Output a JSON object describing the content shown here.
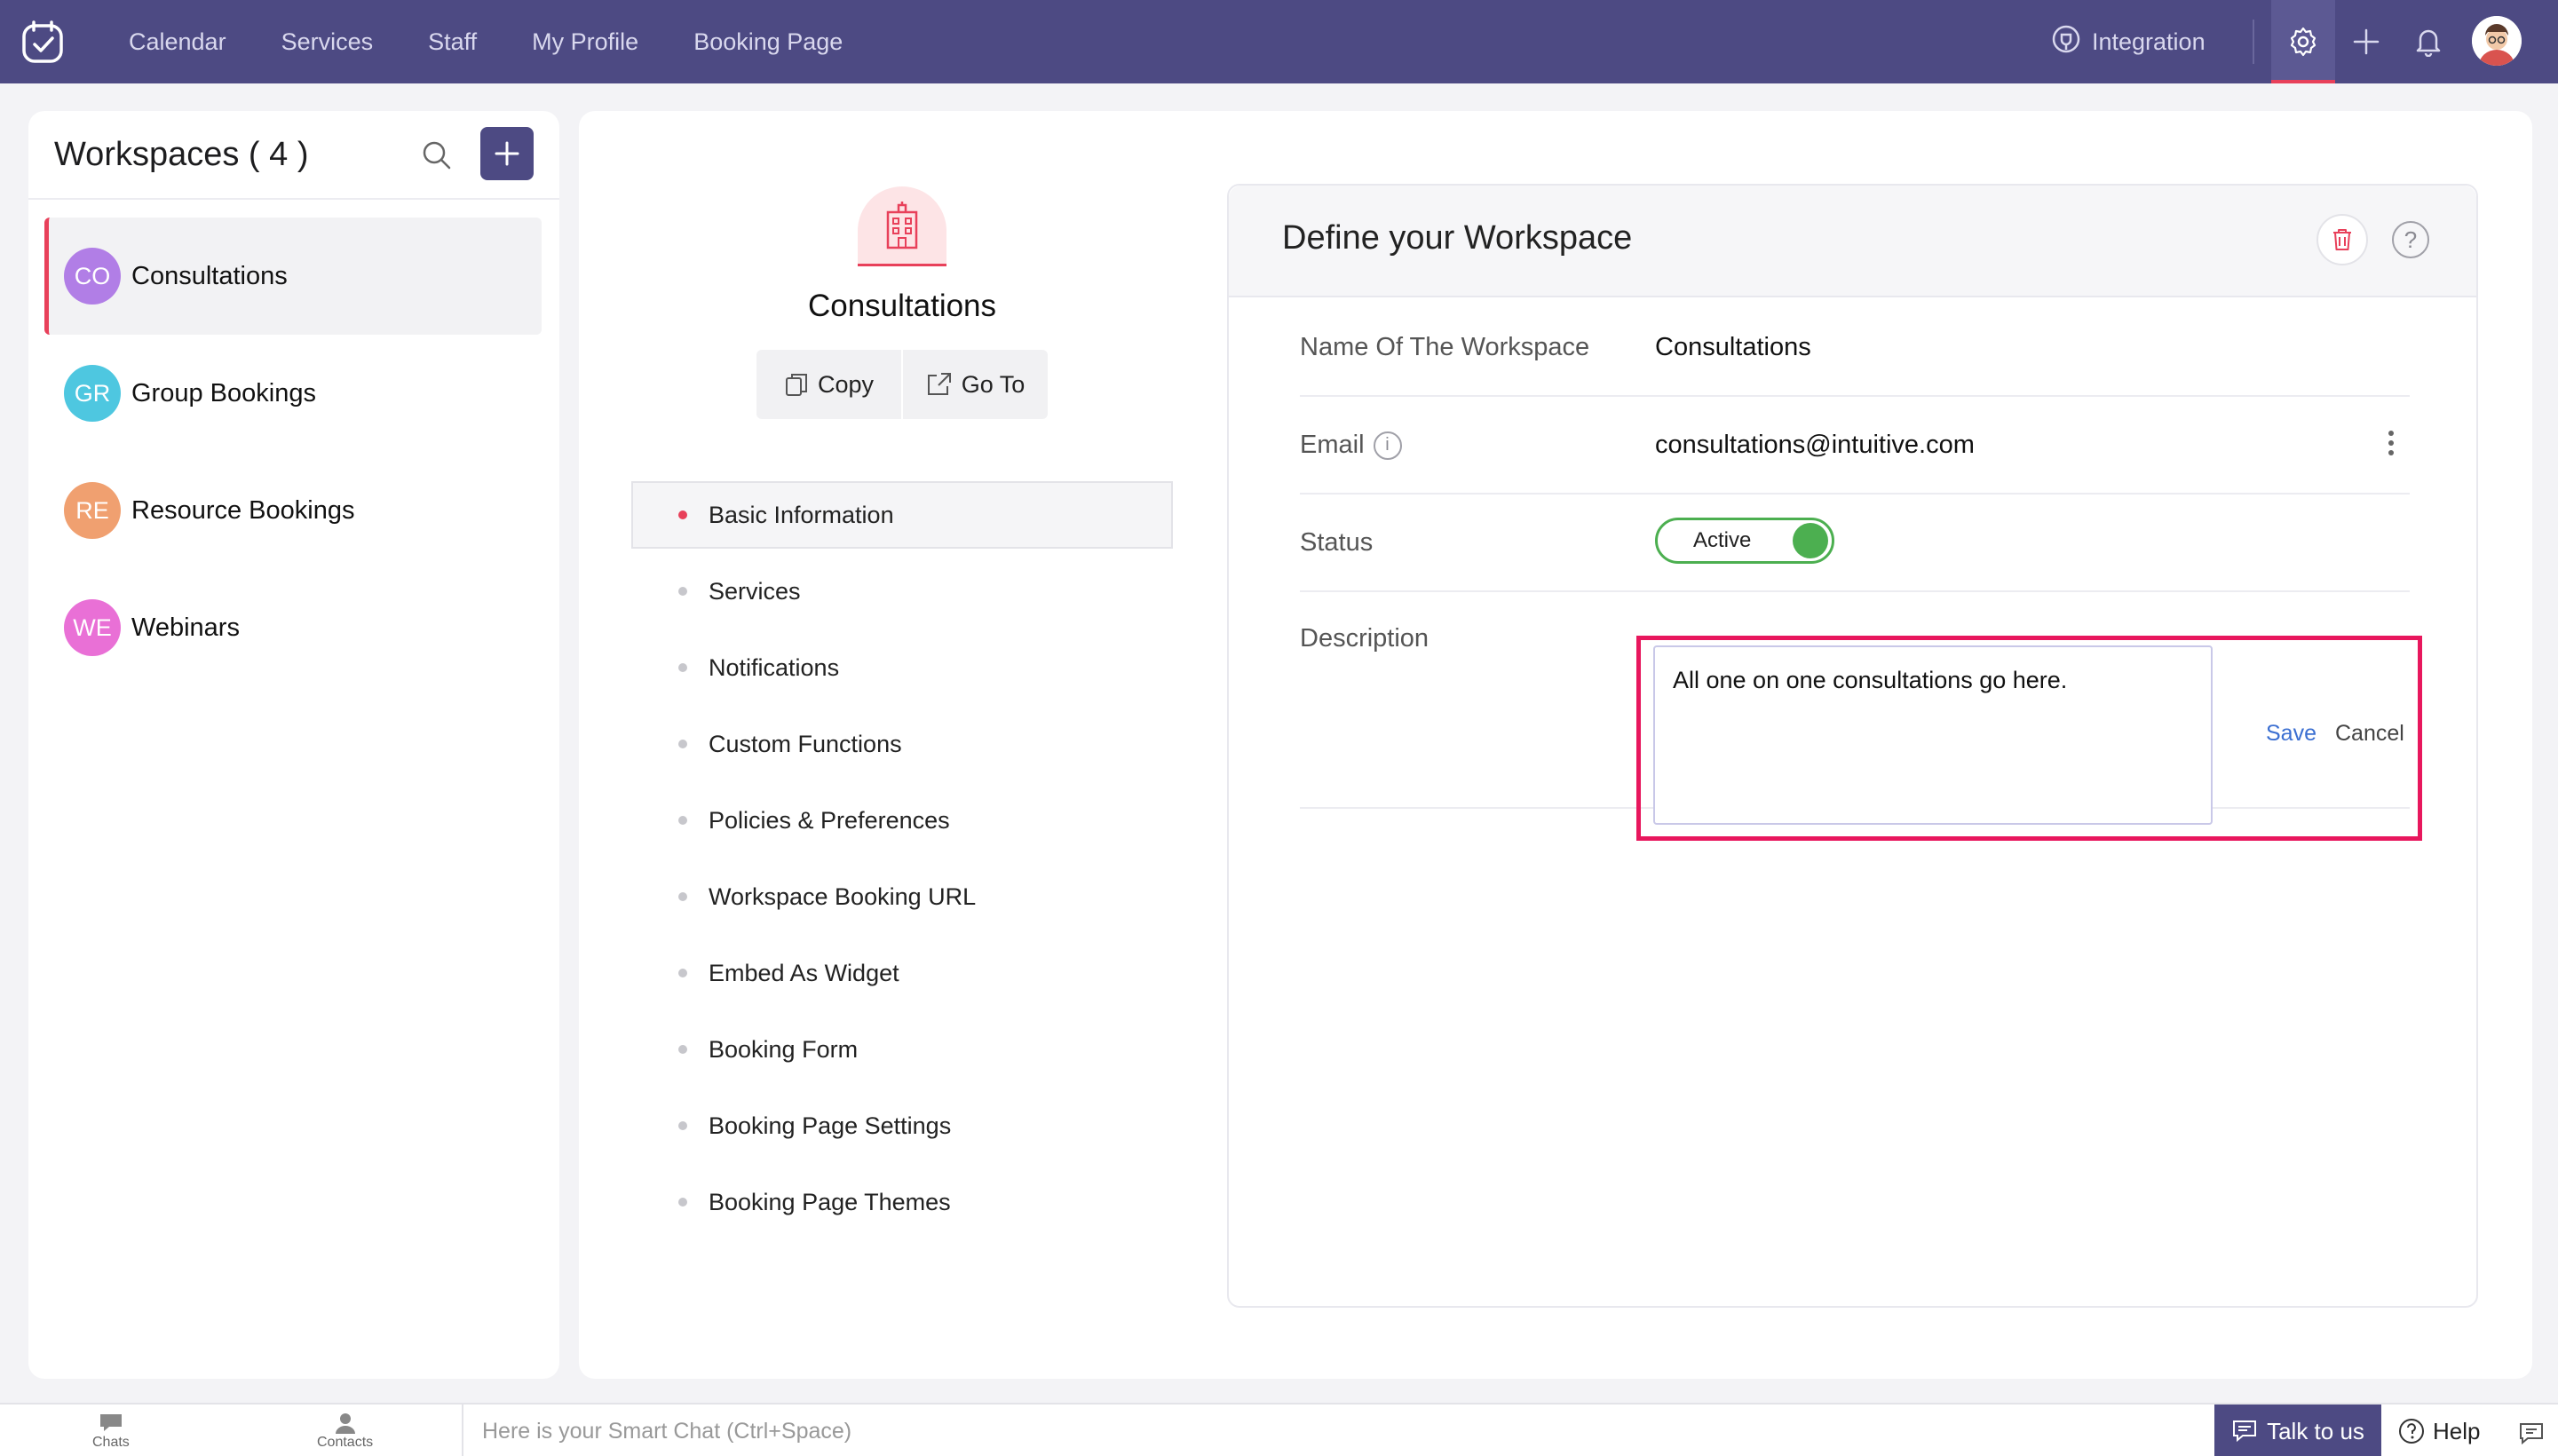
{
  "topbar": {
    "nav": [
      "Calendar",
      "Services",
      "Staff",
      "My Profile",
      "Booking Page"
    ],
    "integration_label": "Integration"
  },
  "sidebar": {
    "title": "Workspaces ( 4 )",
    "items": [
      {
        "initials": "CO",
        "label": "Consultations",
        "color": "#b17ee6",
        "active": true
      },
      {
        "initials": "GR",
        "label": "Group Bookings",
        "color": "#4ec7e0",
        "active": false
      },
      {
        "initials": "RE",
        "label": "Resource Bookings",
        "color": "#f0a070",
        "active": false
      },
      {
        "initials": "WE",
        "label": "Webinars",
        "color": "#e970d6",
        "active": false
      }
    ]
  },
  "workspace": {
    "name": "Consultations",
    "copy_label": "Copy",
    "goto_label": "Go To"
  },
  "subnav": [
    "Basic Information",
    "Services",
    "Notifications",
    "Custom Functions",
    "Policies & Preferences",
    "Workspace Booking URL",
    "Embed As Widget",
    "Booking Form",
    "Booking Page Settings",
    "Booking Page Themes"
  ],
  "define": {
    "title": "Define your Workspace",
    "help_glyph": "?",
    "name_label": "Name Of The Workspace",
    "name_value": "Consultations",
    "email_label": "Email",
    "email_value": "consultations@intuitive.com",
    "status_label": "Status",
    "status_value": "Active",
    "description_label": "Description",
    "description_value": "All one on one consultations go here. ",
    "save_label": "Save",
    "cancel_label": "Cancel"
  },
  "bottombar": {
    "chats_label": "Chats",
    "contacts_label": "Contacts",
    "smart_chat_placeholder": "Here is your Smart Chat (Ctrl+Space)",
    "talk_label": "Talk to us",
    "help_label": "Help"
  },
  "colors": {
    "brand": "#4d4a83",
    "accent": "#e8405a",
    "toggle": "#4caf50",
    "highlight": "#e8175d"
  }
}
